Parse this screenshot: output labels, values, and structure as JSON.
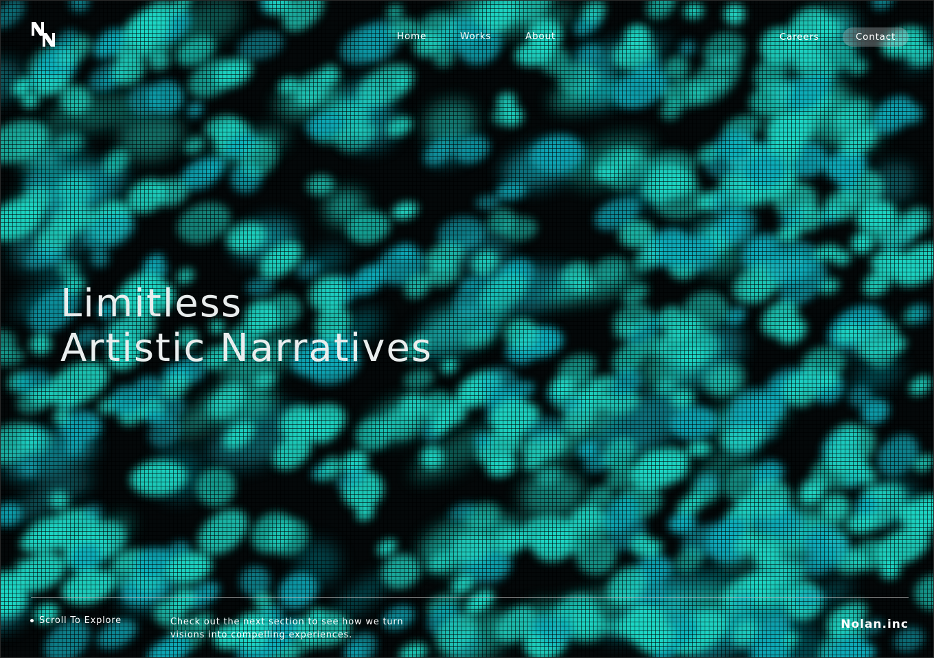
{
  "header": {
    "logo_icon": "nolan-logo-icon",
    "nav": {
      "home": "Home",
      "works": "Works",
      "about": "About"
    },
    "careers": "Careers",
    "contact": "Contact"
  },
  "hero": {
    "line1": "Limitless",
    "line2": "Artistic Narratives"
  },
  "footer": {
    "scroll_label": "Scroll To Explore",
    "description": "Check out the next section to see how we turn visions into compelling experiences.",
    "brand": "Nolan.inc"
  },
  "colors": {
    "background": "#040809",
    "accent": "#1fd6c4",
    "accent_alt": "#0fa9b8"
  }
}
